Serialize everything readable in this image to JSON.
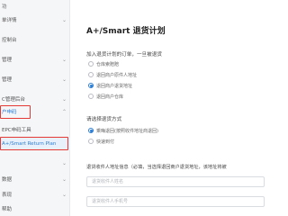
{
  "sidebar": {
    "items": [
      {
        "label": "功",
        "chevron": ""
      },
      {
        "label": "单详情",
        "chevron": "⌄"
      },
      {
        "label": "控制台",
        "chevron": ""
      },
      {
        "label": "管理",
        "chevron": "⌄"
      },
      {
        "label": "管理",
        "chevron": "⌄"
      },
      {
        "label": "C管理后台",
        "chevron": "⌄"
      },
      {
        "label": "户申码",
        "chevron": "⌃"
      },
      {
        "label": "EPC申码工具",
        "chevron": ""
      },
      {
        "label": "A+/Smart Return Plan",
        "chevron": ""
      },
      {
        "label": "",
        "chevron": "⌄"
      },
      {
        "label": "数据",
        "chevron": "⌄"
      },
      {
        "label": "表现",
        "chevron": "⌄"
      },
      {
        "label": "帮助",
        "chevron": ""
      }
    ]
  },
  "main": {
    "title": "A+/Smart 退货计划",
    "order_section": {
      "label": "加入退货计划的订单，一旦被退货",
      "options": [
        "仓库索赔赔",
        "退回商户原件人地址",
        "退回商户退货地址",
        "退回商户仓库"
      ],
      "selected_index": 2
    },
    "method_section": {
      "label": "请选择退货方式",
      "options": [
        "乘晦退回(按照收件地址商退回)",
        "快速到付"
      ],
      "selected_index": 0
    },
    "address_section": {
      "label": "退货收件人地址信息（必填，当选择退回商户退货地址，该地址将被",
      "name_placeholder": "退货收件人姓名",
      "phone_placeholder": "退货收件人手机号"
    }
  }
}
